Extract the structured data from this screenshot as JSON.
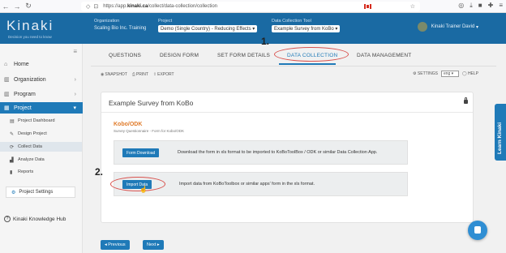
{
  "browser": {
    "url_prefix": "https://app.",
    "url_host": "kinaki.ca",
    "url_path": "/collect/data-collection/collection"
  },
  "header": {
    "logo": "Kinaki",
    "tagline": "Decision you need to know",
    "org_label": "Organization",
    "org_value": "Scaling Bio Inc. Training",
    "project_label": "Project",
    "project_value": "Demo (Single Country) - Reducing Effects",
    "tool_label": "Data Collection Tool",
    "tool_value": "Example Survey from KoBo",
    "user_name": "Kinaki Trainer David"
  },
  "sidebar": {
    "home": "Home",
    "organization": "Organization",
    "program": "Program",
    "project": "Project",
    "sub": [
      "Project Dashboard",
      "Design Project",
      "Collect Data",
      "Analyze Data",
      "Reports"
    ],
    "settings": "Project Settings",
    "hub": "Kinaki Knowledge Hub"
  },
  "tabs": [
    "QUESTIONS",
    "DESIGN FORM",
    "SET FORM DETAILS",
    "DATA COLLECTION",
    "DATA MANAGEMENT"
  ],
  "toolbar": {
    "snapshot": "SNAPSHOT",
    "print": "PRINT",
    "export": "EXPORT",
    "settings": "SETTINGS",
    "lang": "eng",
    "help": "HELP"
  },
  "card": {
    "title": "Example Survey from KoBo",
    "section_title": "Kobo/ODK",
    "section_sub": "Survey Questionnaire - Form for Kobo/ODK",
    "download_btn": "Form Download",
    "download_text": "Download the form in xls format to be imported to KoBoToolBox / ODK or similar Data Collection App.",
    "import_btn": "Import Data",
    "import_text": "Import data from KoBoToolbox or similar apps' form in the xls format."
  },
  "footer": {
    "previous": "◂ Previous",
    "next": "Next ▸"
  },
  "learn": "Learn Kinaki",
  "annotations": [
    "1.",
    "2."
  ],
  "colors": {
    "brand": "#1a6aa3",
    "accent": "#1f7ab8",
    "section": "#e07b2a",
    "annotation": "#d9534f"
  }
}
